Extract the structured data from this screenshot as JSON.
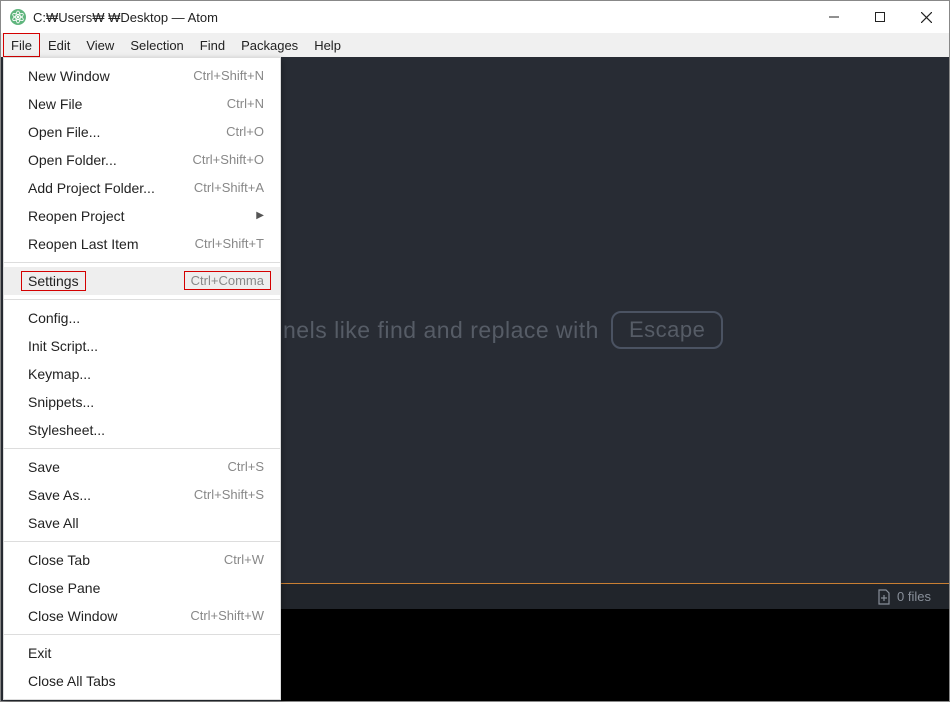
{
  "titlebar": {
    "text": "C:₩Users₩        ₩Desktop — Atom"
  },
  "menubar": {
    "items": [
      {
        "label": "File",
        "highlighted": true
      },
      {
        "label": "Edit"
      },
      {
        "label": "View"
      },
      {
        "label": "Selection"
      },
      {
        "label": "Find"
      },
      {
        "label": "Packages"
      },
      {
        "label": "Help"
      }
    ]
  },
  "dropdown": {
    "groups": [
      [
        {
          "label": "New Window",
          "shortcut": "Ctrl+Shift+N"
        },
        {
          "label": "New File",
          "shortcut": "Ctrl+N"
        },
        {
          "label": "Open File...",
          "shortcut": "Ctrl+O"
        },
        {
          "label": "Open Folder...",
          "shortcut": "Ctrl+Shift+O"
        },
        {
          "label": "Add Project Folder...",
          "shortcut": "Ctrl+Shift+A"
        },
        {
          "label": "Reopen Project",
          "submenu": true
        },
        {
          "label": "Reopen Last Item",
          "shortcut": "Ctrl+Shift+T"
        }
      ],
      [
        {
          "label": "Settings",
          "shortcut": "Ctrl+Comma",
          "hovered": true,
          "labelRed": true,
          "shortcutRed": true
        }
      ],
      [
        {
          "label": "Config..."
        },
        {
          "label": "Init Script..."
        },
        {
          "label": "Keymap..."
        },
        {
          "label": "Snippets..."
        },
        {
          "label": "Stylesheet..."
        }
      ],
      [
        {
          "label": "Save",
          "shortcut": "Ctrl+S"
        },
        {
          "label": "Save As...",
          "shortcut": "Ctrl+Shift+S"
        },
        {
          "label": "Save All"
        }
      ],
      [
        {
          "label": "Close Tab",
          "shortcut": "Ctrl+W"
        },
        {
          "label": "Close Pane"
        },
        {
          "label": "Close Window",
          "shortcut": "Ctrl+Shift+W"
        }
      ],
      [
        {
          "label": "Exit"
        },
        {
          "label": "Close All Tabs"
        }
      ]
    ]
  },
  "hint": {
    "text": "nels like find and replace with",
    "badge": "Escape"
  },
  "statusbar": {
    "files": "0 files"
  }
}
